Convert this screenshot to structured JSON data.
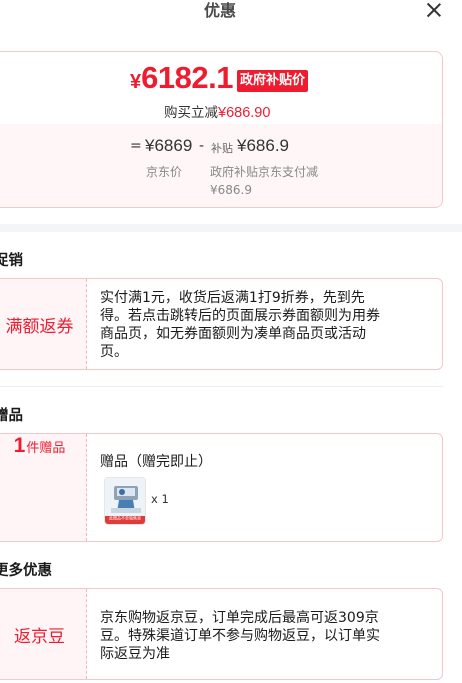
{
  "header": {
    "title": "优惠"
  },
  "price": {
    "currency_symbol": "¥",
    "final_price": "6182.1",
    "subsidy_tag": "政府补贴价",
    "buy_reduce_label": "购买立减",
    "buy_reduce_amount": "¥686.90",
    "equals": "=",
    "jd_price": "¥6869",
    "minus": "-",
    "subsidy_label": "补贴",
    "subsidy_amount": "¥686.9",
    "jd_price_caption": "京东价",
    "subsidy_caption": "政府补贴京东支付减¥686.9"
  },
  "promotion": {
    "section_title": "促销",
    "badge": "满额返券",
    "description": "实付满1元，收货后返满1打9折券，先到先得。若点击跳转后的页面展示券面额则为用券商品页，如无券面额则为凑单商品页或活动页。"
  },
  "gift": {
    "section_title": "赠品",
    "count": "1",
    "count_label": "件赠品",
    "title": "赠品（赠完即止）",
    "quantity": "x 1",
    "thumb_caption": "此赠品不单独售卖"
  },
  "more": {
    "section_title": "更多优惠",
    "badge": "返京豆",
    "description": "京东购物返京豆，订单完成后最高可返309京豆。特殊渠道订单不参与购物返豆，以订单实际返豆为准"
  },
  "colors": {
    "accent": "#ee1c2e",
    "card_border": "#f5c7cb",
    "card_tint": "#fff5f6"
  }
}
